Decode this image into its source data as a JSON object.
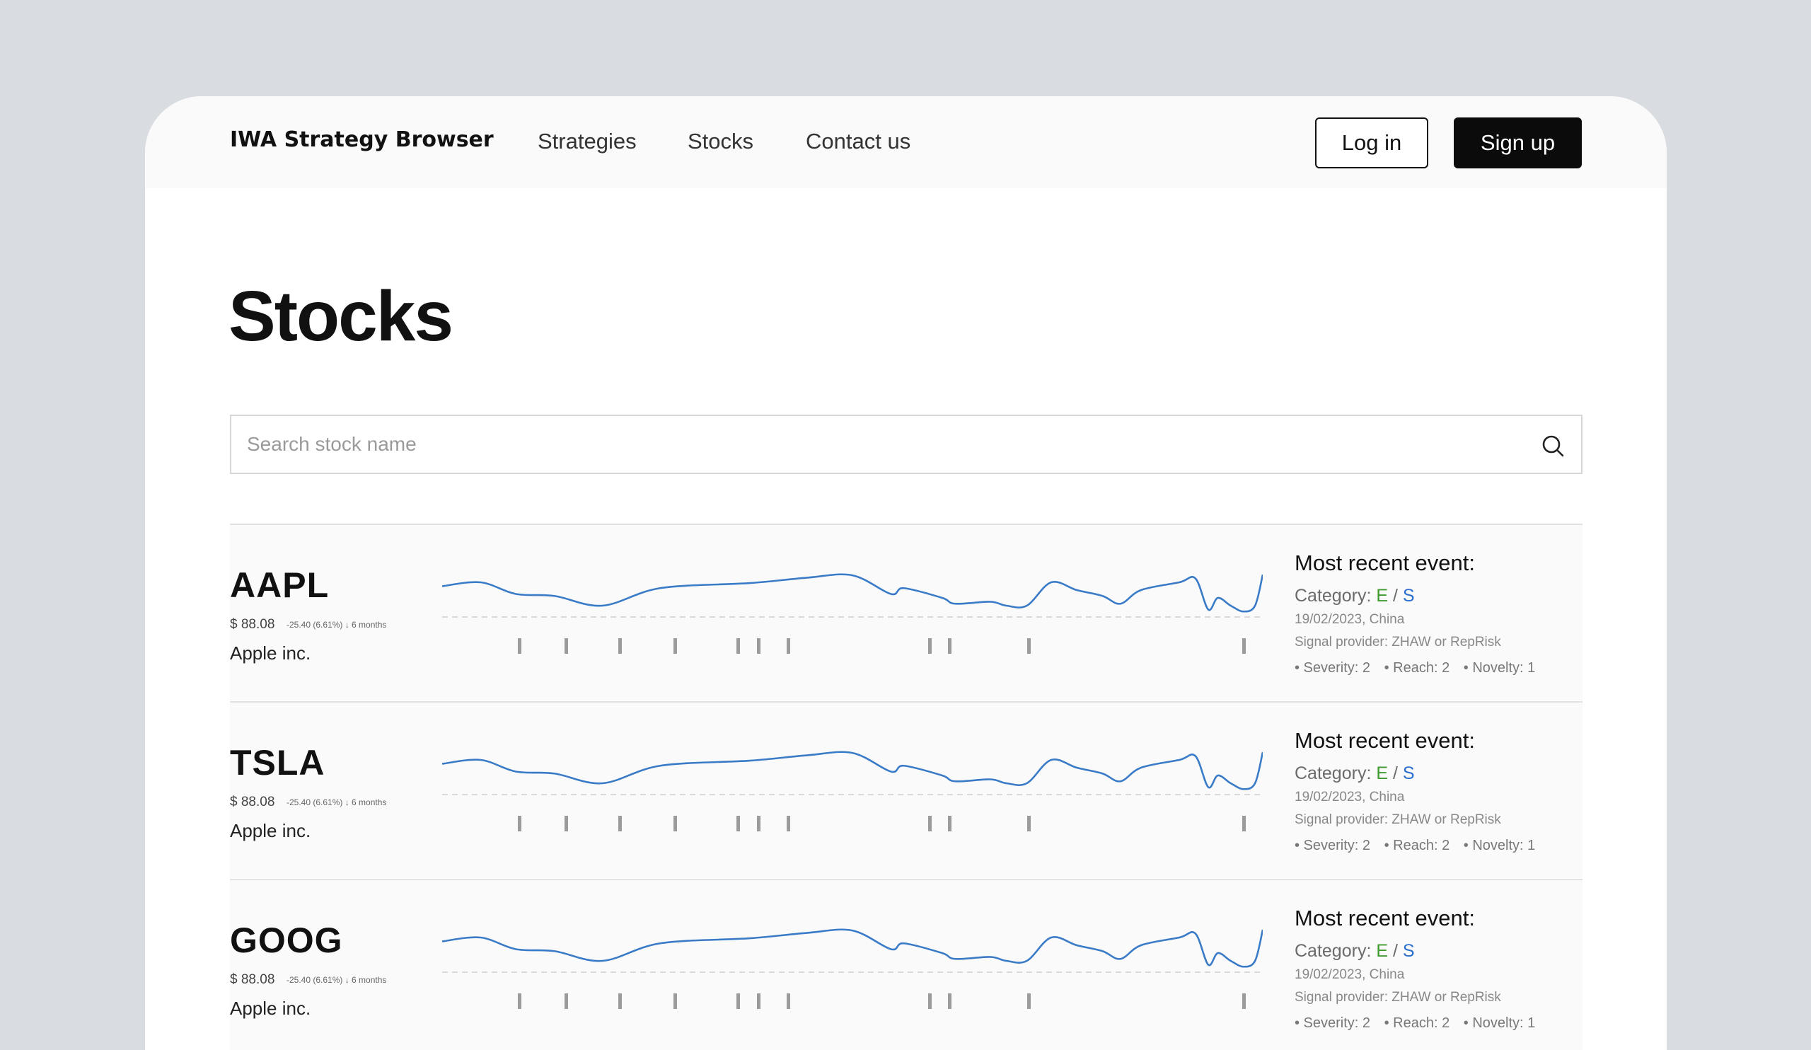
{
  "nav": {
    "brand": "IWA Strategy Browser",
    "links": [
      "Strategies",
      "Stocks",
      "Contact us"
    ],
    "login": "Log in",
    "signup": "Sign up"
  },
  "page": {
    "title": "Stocks"
  },
  "search": {
    "placeholder": "Search stock name",
    "value": ""
  },
  "stocks": [
    {
      "ticker": "AAPL",
      "price": "$ 88.08",
      "change": "-25.40 (6.61%) ↓ 6 months",
      "company": "Apple inc.",
      "event": {
        "title": "Most recent event:",
        "category_label": "Category:",
        "cat_e": "E",
        "sep": "/",
        "cat_s": "S",
        "date": "19/02/2023, China",
        "provider": "Signal provider: ZHAW or RepRisk",
        "severity": "• Severity: 2",
        "reach": "• Reach: 2",
        "novelty": "• Novelty: 1"
      }
    },
    {
      "ticker": "TSLA",
      "price": "$ 88.08",
      "change": "-25.40 (6.61%) ↓ 6 months",
      "company": "Apple inc.",
      "event": {
        "title": "Most recent event:",
        "category_label": "Category:",
        "cat_e": "E",
        "sep": "/",
        "cat_s": "S",
        "date": "19/02/2023, China",
        "provider": "Signal provider: ZHAW or RepRisk",
        "severity": "• Severity: 2",
        "reach": "• Reach: 2",
        "novelty": "• Novelty: 1"
      }
    },
    {
      "ticker": "GOOG",
      "price": "$ 88.08",
      "change": "-25.40 (6.61%) ↓ 6 months",
      "company": "Apple inc.",
      "event": {
        "title": "Most recent event:",
        "category_label": "Category:",
        "cat_e": "E",
        "sep": "/",
        "cat_s": "S",
        "date": "19/02/2023, China",
        "provider": "Signal provider: ZHAW or RepRisk",
        "severity": "• Severity: 2",
        "reach": "• Reach: 2",
        "novelty": "• Novelty: 1"
      }
    }
  ],
  "colors": {
    "sparkline": "#3a7bc8",
    "baseline": "#cfcfcf",
    "event_marker": "#9b9b9b",
    "category_e": "#3f9b2e",
    "category_s": "#2a6fcf"
  },
  "icons": {
    "search": "search-icon"
  }
}
